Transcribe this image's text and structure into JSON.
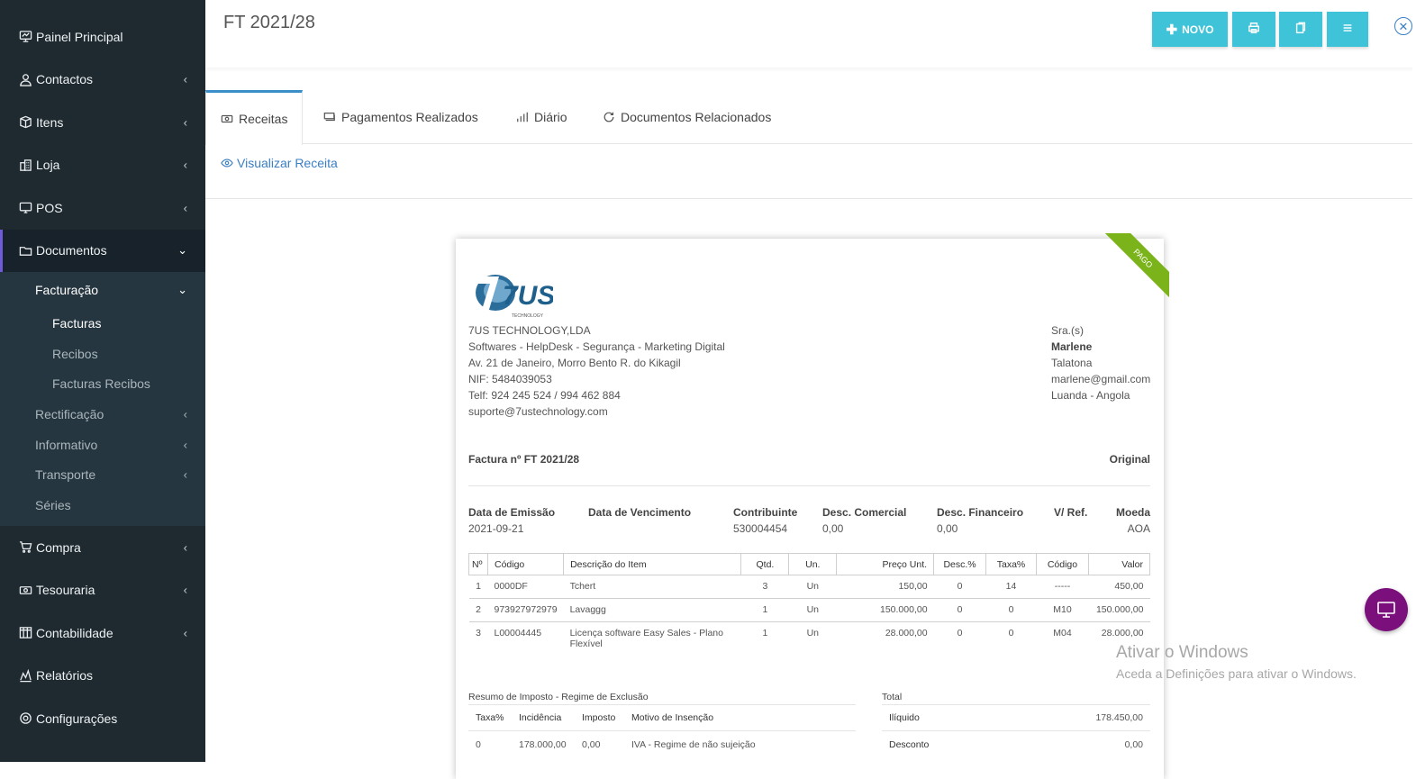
{
  "sidebar": {
    "items": [
      {
        "label": "Painel Principal",
        "icon": "dashboard-icon"
      },
      {
        "label": "Contactos",
        "icon": "user-icon"
      },
      {
        "label": "Itens",
        "icon": "box-icon"
      },
      {
        "label": "Loja",
        "icon": "building-icon"
      },
      {
        "label": "POS",
        "icon": "monitor-icon"
      },
      {
        "label": "Documentos",
        "icon": "folder-icon"
      },
      {
        "label": "Compra",
        "icon": "cart-icon"
      },
      {
        "label": "Tesouraria",
        "icon": "money-icon"
      },
      {
        "label": "Contabilidade",
        "icon": "ledger-icon"
      },
      {
        "label": "Relatórios",
        "icon": "chart-icon"
      },
      {
        "label": "Configurações",
        "icon": "gear-icon"
      }
    ],
    "documentos_sub": {
      "facturacao": "Facturação",
      "facturacao_items": [
        "Facturas",
        "Recibos",
        "Facturas Recibos"
      ],
      "rectificacao": "Rectificação",
      "informativo": "Informativo",
      "transporte": "Transporte",
      "series": "Séries"
    }
  },
  "header": {
    "title": "FT 2021/28",
    "new_label": "NOVO"
  },
  "tabs": [
    {
      "label": "Receitas"
    },
    {
      "label": "Pagamentos Realizados"
    },
    {
      "label": "Diário"
    },
    {
      "label": "Documentos Relacionados"
    }
  ],
  "view_link": "Visualizar Receita",
  "invoice": {
    "ribbon": "PAGO",
    "company": {
      "name": "7US TECHNOLOGY,LDA",
      "tagline": "Softwares - HelpDesk - Segurança - Marketing Digital",
      "address": "Av. 21 de Janeiro, Morro Bento R. do Kikagil",
      "nif": "NIF: 5484039053",
      "tel": "Telf: 924 245 524 / 994 462 884",
      "email": "suporte@7ustechnology.com",
      "logo_text": "7US",
      "logo_sub": "TECHNOLOGY"
    },
    "client": {
      "salutation": "Sra.(s)",
      "name": "Marlene",
      "area": "Talatona",
      "email": "marlene@gmail.com",
      "city": "Luanda - Angola"
    },
    "title": "Factura nº FT 2021/28",
    "copy": "Original",
    "meta": {
      "headers": [
        "Data de Emissão",
        "Data de Vencimento",
        "Contribuinte",
        "Desc. Comercial",
        "Desc. Financeiro",
        "V/ Ref.",
        "Moeda"
      ],
      "values": [
        "2021-09-21",
        "",
        "530004454",
        "0,00",
        "0,00",
        "",
        "AOA"
      ]
    },
    "table": {
      "headers": [
        "Nº",
        "Código",
        "Descrição do Item",
        "Qtd.",
        "Un.",
        "Preço Unt.",
        "Desc.%",
        "Taxa%",
        "Código",
        "Valor"
      ],
      "rows": [
        [
          "1",
          "0000DF",
          "Tchert",
          "3",
          "Un",
          "150,00",
          "0",
          "14",
          "-----",
          "450,00"
        ],
        [
          "2",
          "973927972979",
          "Lavaggg",
          "1",
          "Un",
          "150.000,00",
          "0",
          "0",
          "M10",
          "150.000,00"
        ],
        [
          "3",
          "L00004445",
          "Licença software Easy Sales - Plano Flexível",
          "1",
          "Un",
          "28.000,00",
          "0",
          "0",
          "M04",
          "28.000,00"
        ]
      ]
    },
    "tax_summary": {
      "title": "Resumo de Imposto - Regime de Exclusão",
      "headers": [
        "Taxa%",
        "Incidência",
        "Imposto",
        "Motivo de Insenção"
      ],
      "row": [
        "0",
        "178.000,00",
        "0,00",
        "IVA - Regime de não sujeição"
      ]
    },
    "totals": {
      "title": "Total",
      "rows": [
        {
          "label": "Ilíquido",
          "value": "178.450,00"
        },
        {
          "label": "Desconto",
          "value": "0,00"
        }
      ]
    }
  },
  "windows_notice": {
    "line1": "Ativar o Windows",
    "line2": "Aceda a Definições para ativar o Windows."
  },
  "colors": {
    "sidebar_bg": "#1e2a30",
    "accent_button": "#3fc3d8",
    "active_tab_border": "#3a8fc9",
    "ribbon": "#7bb31a",
    "float_button": "#7b0f7b"
  }
}
